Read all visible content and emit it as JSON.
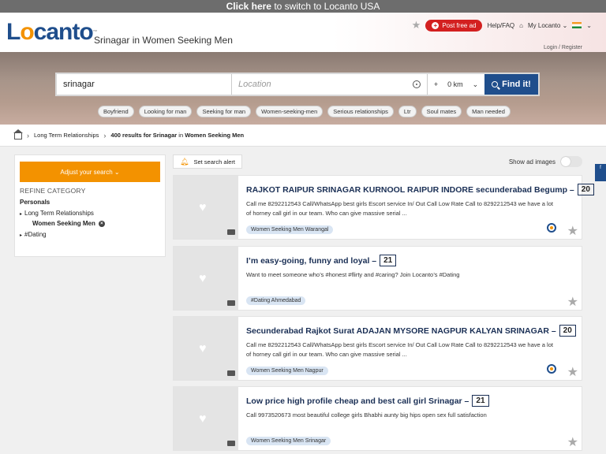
{
  "topbar": {
    "link": "Click here",
    "rest": " to switch to Locanto USA"
  },
  "header": {
    "logo_a": "L",
    "logo_o": "o",
    "logo_rest": "canto",
    "logo_tm": "™",
    "title": "Srinagar in Women Seeking Men",
    "post_label": "Post free ad",
    "help": "Help/FAQ",
    "my_locanto": "My Locanto",
    "login": "Login / Register"
  },
  "search": {
    "what_value": "srinagar",
    "where_placeholder": "Location",
    "radius_plus": "+",
    "radius": "0 km",
    "find_label": "Find it!"
  },
  "chips": [
    "Boyfriend",
    "Looking for man",
    "Seeking for man",
    "Women-seeking-men",
    "Serious relationships",
    "Ltr",
    "Soul mates",
    "Man needed"
  ],
  "breadcrumb": {
    "item1": "Long Term Relationships",
    "count": "400 results for Srinagar",
    "in": " in ",
    "cat": "Women Seeking Men"
  },
  "sidebar": {
    "adjust": "Adjust your search",
    "refine": "REFINE CATEGORY",
    "personals": "Personals",
    "ltr": "Long Term Relationships",
    "wsm": "Women Seeking Men",
    "dating": "#Dating"
  },
  "toolbar": {
    "alert": "Set search alert",
    "show_images": "Show ad images"
  },
  "listings": [
    {
      "title": "RAJKOT RAIPUR SRINAGAR KURNOOL RAIPUR INDORE secunderabad Begump –",
      "age": "20",
      "desc": "Call me 8292212543 Call/WhatsApp best girls Escort service In/ Out Call Low Rate Call to 8292212543 we have a lot of horney call girl in our team. Who can give massive serial ...",
      "tag": "Women Seeking Men Warangal"
    },
    {
      "title": "I’m easy-going, funny and loyal –",
      "age": "21",
      "desc": "Want to meet someone who’s #honest #flirty and #caring? Join Locanto’s #Dating",
      "tag": "#Dating Ahmedabad"
    },
    {
      "title": "Secunderabad Rajkot Surat ADAJAN MYSORE NAGPUR KALYAN SRINAGAR –",
      "age": "20",
      "desc": "Call me 8292212543 Call/WhatsApp best girls Escort service In/ Out Call Low Rate Call to 8292212543 we have a lot of horney call girl in our team. Who can give massive serial ...",
      "tag": "Women Seeking Men Nagpur"
    },
    {
      "title": "Low price high profile cheap and best call girl Srinagar –",
      "age": "21",
      "desc": "Call 9973520673 most beautiful college girls Bhabhi aunty big hips open sex full satisfaction",
      "tag": "Women Seeking Men Srinagar"
    }
  ],
  "colors": {
    "brand_blue": "#1f4e8c",
    "brand_orange": "#f39200",
    "post_red": "#d32020"
  }
}
